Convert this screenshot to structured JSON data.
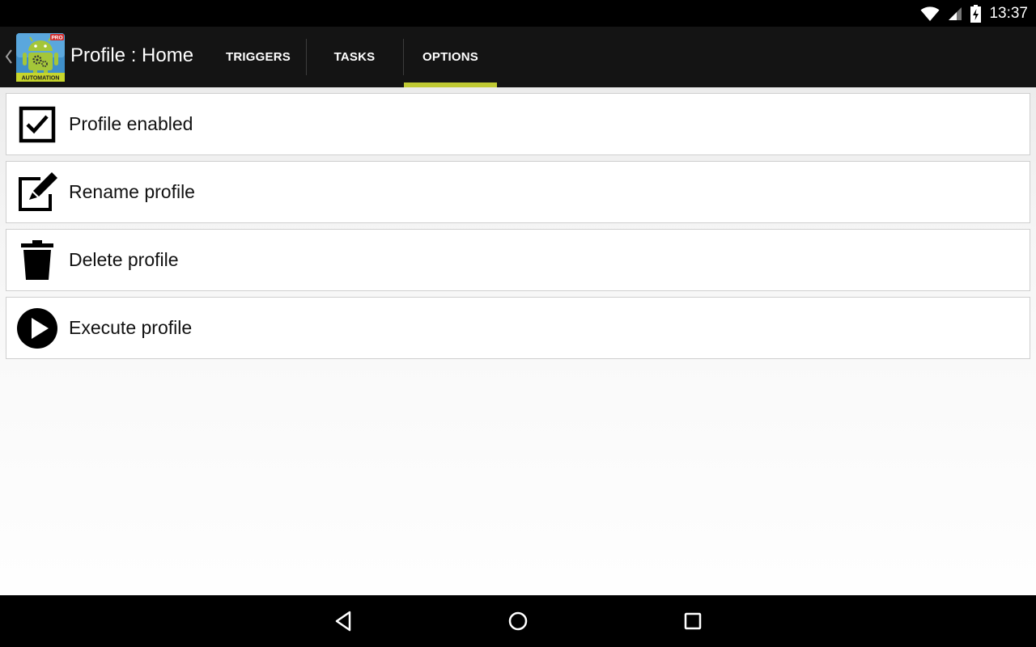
{
  "status_bar": {
    "time": "13:37",
    "icons": [
      "wifi-icon",
      "cell-signal-icon",
      "battery-charging-icon"
    ]
  },
  "action_bar": {
    "up_icon": "chevron-left-icon",
    "app_icon": "automation-pro-app-icon",
    "app_icon_badge": "PRO",
    "app_icon_caption": "AUTOMATION",
    "title": "Profile : Home",
    "accent_color": "#c0ca33",
    "tabs": [
      {
        "label": "TRIGGERS",
        "selected": false
      },
      {
        "label": "TASKS",
        "selected": false
      },
      {
        "label": "OPTIONS",
        "selected": true
      }
    ]
  },
  "options": [
    {
      "label": "Profile enabled",
      "icon": "checkbox-checked-icon"
    },
    {
      "label": "Rename profile",
      "icon": "edit-icon"
    },
    {
      "label": "Delete profile",
      "icon": "trash-icon"
    },
    {
      "label": "Execute profile",
      "icon": "play-circle-icon"
    }
  ],
  "nav_bar": {
    "icons": [
      "back-icon",
      "home-icon",
      "recents-icon"
    ]
  }
}
